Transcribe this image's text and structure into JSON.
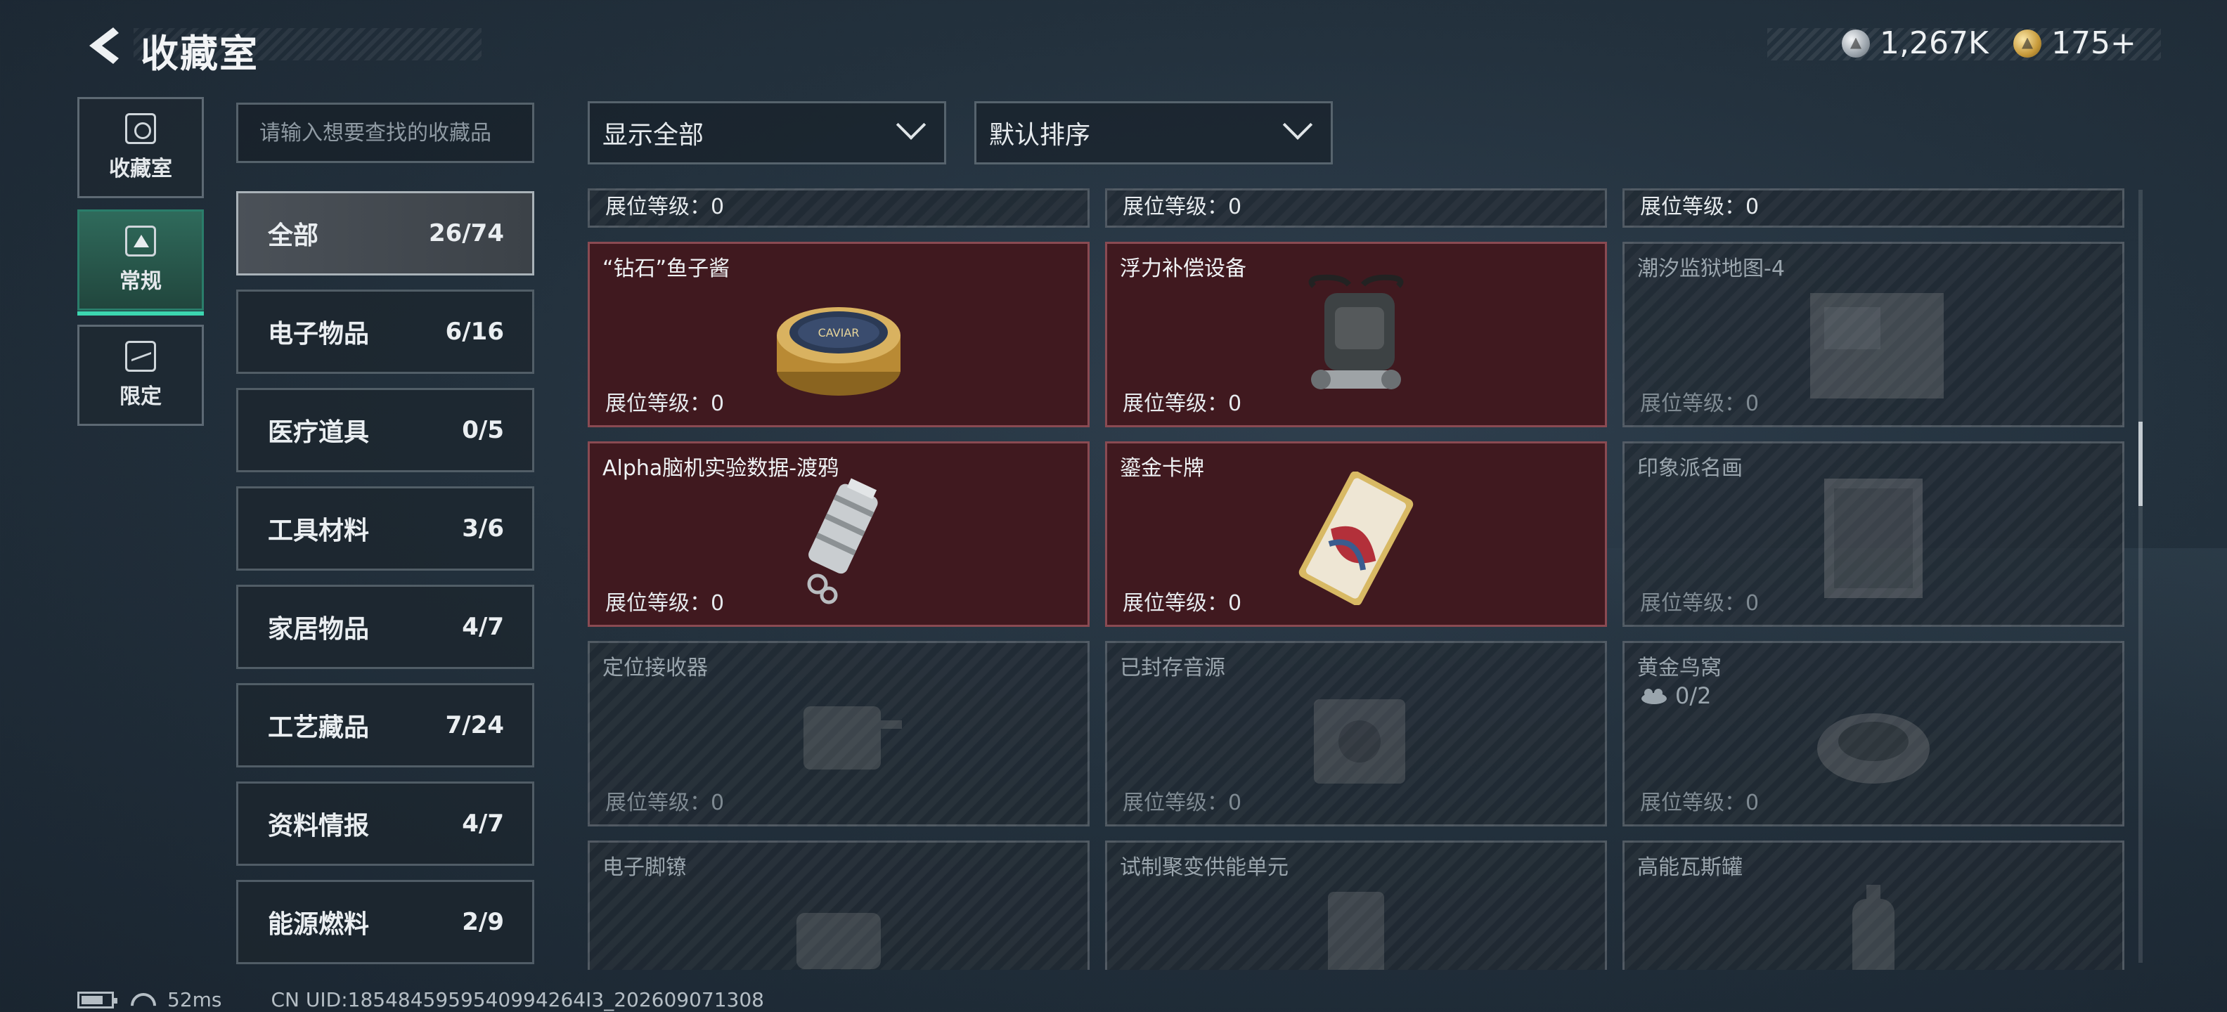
{
  "header": {
    "title": "收藏室",
    "currency": [
      {
        "icon": "silver-coin-icon",
        "value": "1,267K"
      },
      {
        "icon": "gold-coin-icon",
        "value": "175+"
      }
    ]
  },
  "mode_tabs": [
    {
      "label": "收藏室",
      "icon": "collection-room-icon",
      "active": false
    },
    {
      "label": "常规",
      "icon": "regular-icon",
      "active": true
    },
    {
      "label": "限定",
      "icon": "limited-icon",
      "active": false
    }
  ],
  "search": {
    "placeholder": "请输入想要查找的收藏品"
  },
  "categories": [
    {
      "name": "全部",
      "count": "26/74",
      "active": true
    },
    {
      "name": "电子物品",
      "count": "6/16",
      "active": false
    },
    {
      "name": "医疗道具",
      "count": "0/5",
      "active": false
    },
    {
      "name": "工具材料",
      "count": "3/6",
      "active": false
    },
    {
      "name": "家居物品",
      "count": "4/7",
      "active": false
    },
    {
      "name": "工艺藏品",
      "count": "7/24",
      "active": false
    },
    {
      "name": "资料情报",
      "count": "4/7",
      "active": false
    },
    {
      "name": "能源燃料",
      "count": "2/9",
      "active": false
    }
  ],
  "filters": {
    "display": "显示全部",
    "sort": "默认排序"
  },
  "level_label": "展位等级：0",
  "items_partial": [
    {
      "level": "展位等级：0"
    },
    {
      "level": "展位等级：0"
    },
    {
      "level": "展位等级：0"
    }
  ],
  "items": [
    {
      "name": "“钻石”鱼子酱",
      "level": "展位等级：0",
      "owned": true,
      "art": "caviar-tin-icon"
    },
    {
      "name": "浮力补偿设备",
      "level": "展位等级：0",
      "owned": true,
      "art": "buoyancy-device-icon"
    },
    {
      "name": "潮汐监狱地图-4",
      "level": "展位等级：0",
      "owned": false,
      "art": "map-icon"
    },
    {
      "name": "Alpha脑机实验数据-渡鸦",
      "level": "展位等级：0",
      "owned": true,
      "art": "data-canister-icon"
    },
    {
      "name": "鎏金卡牌",
      "level": "展位等级：0",
      "owned": true,
      "art": "gilded-card-icon"
    },
    {
      "name": "印象派名画",
      "level": "展位等级：0",
      "owned": false,
      "art": "painting-icon"
    },
    {
      "name": "定位接收器",
      "level": "展位等级：0",
      "owned": false,
      "art": "receiver-icon"
    },
    {
      "name": "已封存音源",
      "level": "展位等级：0",
      "owned": false,
      "art": "audio-source-icon"
    },
    {
      "name": "黄金鸟窝",
      "level": "展位等级：0",
      "owned": false,
      "art": "gold-nest-icon",
      "sub": "0/2"
    },
    {
      "name": "电子脚镣",
      "level": "",
      "owned": false,
      "art": "ankle-monitor-icon"
    },
    {
      "name": "试制聚变供能单元",
      "level": "",
      "owned": false,
      "art": "fusion-cell-icon"
    },
    {
      "name": "高能瓦斯罐",
      "level": "",
      "owned": false,
      "art": "gas-tank-icon"
    }
  ],
  "footer": {
    "ping": "52ms",
    "uid": "CN UID:1854845959540994264I3_202609071308"
  }
}
